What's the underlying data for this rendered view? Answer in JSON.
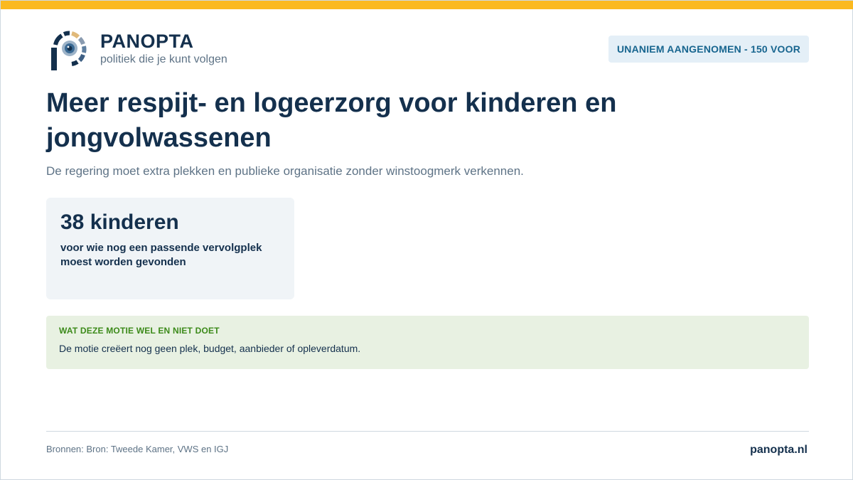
{
  "colors": {
    "accent_bar": "#fbb91f",
    "navy": "#14304d",
    "muted": "#5e7386",
    "badge_bg": "#e4eff7",
    "badge_text": "#17658f",
    "stat_bg": "#f0f4f7",
    "info_bg": "#e8f1e2",
    "info_heading": "#3c8a1a"
  },
  "brand": {
    "name": "PANOPTA",
    "tagline": "politiek die je kunt volgen",
    "logo_icon": "eye-p-logo-icon"
  },
  "status_badge": "UNANIEM AANGENOMEN - 150 VOOR",
  "title": "Meer respijt- en logeerzorg voor kinderen en jongvolwassenen",
  "subtitle": "De regering moet extra plekken en publieke organisatie zonder winstoogmerk verkennen.",
  "stat": {
    "value": "38 kinderen",
    "description": "voor wie nog een passende vervolgplek moest worden gevonden"
  },
  "info": {
    "heading": "WAT DEZE MOTIE WEL EN NIET DOET",
    "text": "De motie creëert nog geen plek, budget, aanbieder of opleverdatum."
  },
  "footer": {
    "sources": "Bronnen: Bron: Tweede Kamer, VWS en IGJ",
    "site": "panopta.nl"
  }
}
